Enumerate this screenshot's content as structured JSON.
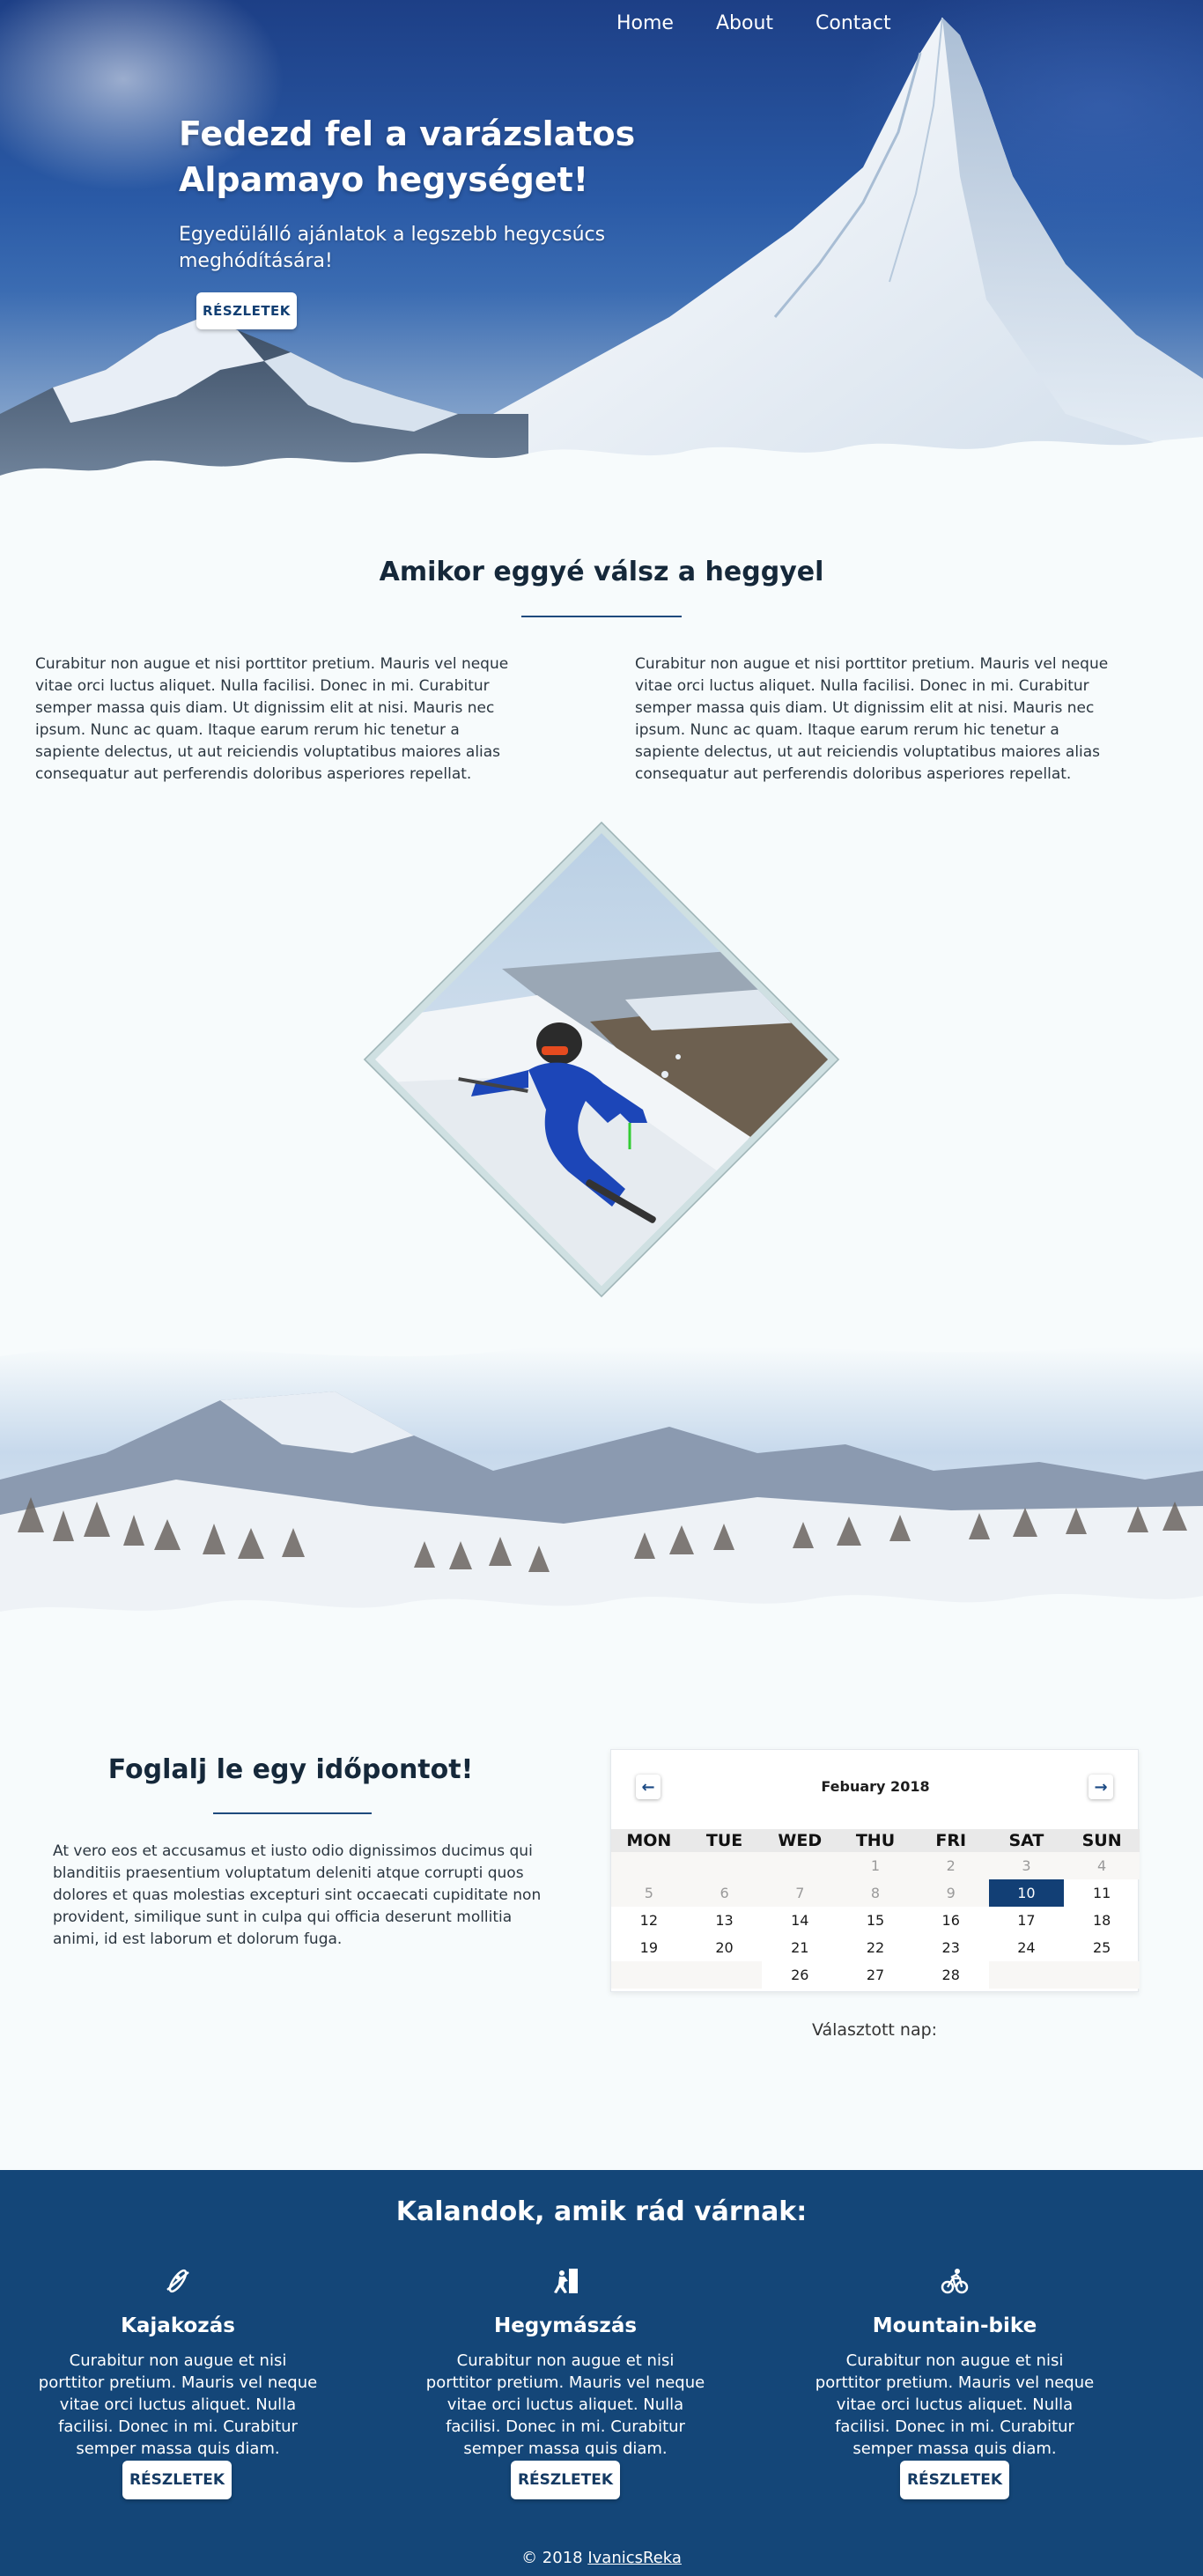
{
  "nav": {
    "items": [
      "Home",
      "About",
      "Contact"
    ]
  },
  "hero": {
    "title": "Fedezd fel a varázslatos Alpamayo hegységet!",
    "subtitle": "Egyedülálló ajánlatok a legszebb hegycsúcs meghódítására!",
    "button": "RÉSZLETEK"
  },
  "intro": {
    "title": "Amikor eggyé válsz a heggyel",
    "left_text": "Curabitur non augue et nisi porttitor pretium. Mauris vel neque vitae orci luctus aliquet. Nulla facilisi. Donec in mi. Curabitur semper massa quis diam. Ut dignissim elit at nisi. Mauris nec ipsum. Nunc ac quam. Itaque earum rerum hic tenetur a sapiente delectus, ut aut reiciendis voluptatibus maiores alias consequatur aut perferendis doloribus asperiores repellat.",
    "right_text": "Curabitur non augue et nisi porttitor pretium. Mauris vel neque vitae orci luctus aliquet. Nulla facilisi. Donec in mi. Curabitur semper massa quis diam. Ut dignissim elit at nisi. Mauris nec ipsum. Nunc ac quam. Itaque earum rerum hic tenetur a sapiente delectus, ut aut reiciendis voluptatibus maiores alias consequatur aut perferendis doloribus asperiores repellat."
  },
  "booking": {
    "title": "Foglalj le egy időpontot!",
    "text": "At vero eos et accusamus et iusto odio dignissimos ducimus qui blanditiis praesentium voluptatum deleniti atque corrupti quos dolores et quas molestias excepturi sint occaecati cupiditate non provident, similique sunt in culpa qui officia deserunt mollitia animi, id est laborum et dolorum fuga.",
    "calendar": {
      "month_label": "Febuary 2018",
      "prev_icon": "arrow-left-icon",
      "next_icon": "arrow-right-icon",
      "weekdays": [
        "MON",
        "TUE",
        "WED",
        "THU",
        "FRI",
        "SAT",
        "SUN"
      ],
      "weeks": [
        [
          "",
          "",
          "",
          "1",
          "2",
          "3",
          "4"
        ],
        [
          "5",
          "6",
          "7",
          "8",
          "9",
          "10",
          "11"
        ],
        [
          "12",
          "13",
          "14",
          "15",
          "16",
          "17",
          "18"
        ],
        [
          "19",
          "20",
          "21",
          "22",
          "23",
          "24",
          "25"
        ],
        [
          "",
          "",
          "26",
          "27",
          "28",
          "",
          ""
        ]
      ],
      "selected_day": "10",
      "muted_days": [
        "1",
        "2",
        "3",
        "4",
        "5",
        "6",
        "7",
        "8",
        "9"
      ],
      "caption": "Választott nap:"
    }
  },
  "adventures": {
    "title": "Kalandok, amik rád várnak:",
    "items": [
      {
        "icon": "kayak-icon",
        "title": "Kajakozás",
        "text": "Curabitur non augue et nisi porttitor pretium. Mauris vel neque vitae orci luctus aliquet. Nulla facilisi. Donec in mi. Curabitur semper massa quis diam.",
        "button": "RÉSZLETEK"
      },
      {
        "icon": "climbing-icon",
        "title": "Hegymászás",
        "text": "Curabitur non augue et nisi porttitor pretium. Mauris vel neque vitae orci luctus aliquet. Nulla facilisi. Donec in mi. Curabitur semper massa quis diam.",
        "button": "RÉSZLETEK"
      },
      {
        "icon": "mountain-bike-icon",
        "title": "Mountain-bike",
        "text": "Curabitur non augue et nisi porttitor pretium. Mauris vel neque vitae orci luctus aliquet. Nulla facilisi. Donec in mi. Curabitur semper massa quis diam.",
        "button": "RÉSZLETEK"
      }
    ]
  },
  "footer": {
    "prefix": "© 2018",
    "author": "IvanicsReka"
  },
  "colors": {
    "brand_blue": "#144678",
    "selected_day": "#123f75",
    "page_background": "#f7fbfc"
  }
}
